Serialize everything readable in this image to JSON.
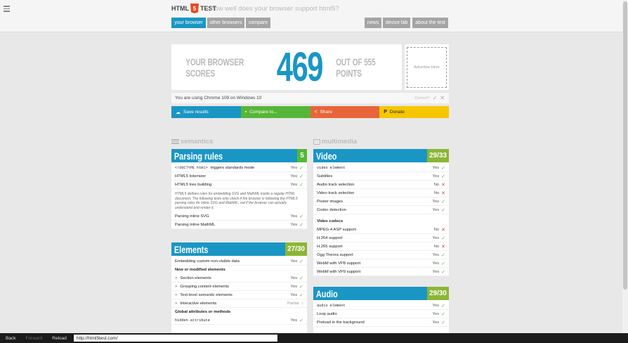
{
  "header": {
    "logo_left": "HTML",
    "logo_shield": "5",
    "logo_right": "TEST",
    "tagline": "how well does your browser support html5?"
  },
  "nav": {
    "your_browser": "your browser",
    "other_browsers": "other browsers",
    "compare": "compare",
    "news": "news",
    "device_lab": "device lab",
    "about": "about the test"
  },
  "score": {
    "prefix": "YOUR BROWSER SCORES",
    "value": "469",
    "suffix": "OUT OF 555 POINTS"
  },
  "ad": {
    "label": "Advertise Here"
  },
  "ua": {
    "text": "You are using Chrome 109 on Windows 10",
    "correct": "Correct?"
  },
  "actions": {
    "save": "Save results",
    "compare": "Compare to...",
    "share": "Share",
    "donate": "Donate"
  },
  "colors": {
    "blue": "#1a96c5",
    "green": "#56b638",
    "orange": "#e8643a",
    "yellow": "#f6c700"
  },
  "sections": {
    "semantics": "semantics",
    "multimedia": "multimedia"
  },
  "parsing": {
    "title": "Parsing rules",
    "score": "5",
    "rows": [
      {
        "label": "<!DOCTYPE html> triggers standards mode",
        "result": "Yes"
      },
      {
        "label": "HTML5 tokenizer",
        "result": "Yes"
      },
      {
        "label": "HTML5 tree building",
        "result": "Yes"
      }
    ],
    "note": "HTML5 defines rules for embedding SVG and MathML inside a regular HTML document. The following tests only check if the browser is following the HTML5 parsing rules for inline SVG and MathML, not if the browser can actually understand and render it.",
    "rows2": [
      {
        "label": "Parsing inline SVG",
        "result": "Yes"
      },
      {
        "label": "Parsing inline MathML",
        "result": "Yes"
      }
    ]
  },
  "elements": {
    "title": "Elements",
    "score": "27/30",
    "rows": [
      {
        "label": "Embedding custom non-visible data",
        "result": "Yes"
      }
    ],
    "group1": "New or modified elements",
    "rows2": [
      {
        "label": "Section elements",
        "result": "Yes"
      },
      {
        "label": "Grouping content elements",
        "result": "Yes"
      },
      {
        "label": "Text-level semantic elements",
        "result": "Yes"
      },
      {
        "label": "Interactive elements",
        "result": "Partial"
      }
    ],
    "group2": "Global attributes or methods",
    "rows3": [
      {
        "label": "hidden attribute",
        "result": "Yes"
      }
    ]
  },
  "video": {
    "title": "Video",
    "score": "29/33",
    "rows": [
      {
        "label": "video element",
        "result": "Yes"
      },
      {
        "label": "Subtitles",
        "result": "Yes"
      },
      {
        "label": "Audio track selection",
        "result": "No"
      },
      {
        "label": "Video track selection",
        "result": "No"
      },
      {
        "label": "Poster images",
        "result": "Yes"
      },
      {
        "label": "Codec detection",
        "result": "Yes"
      }
    ],
    "group": "Video codecs",
    "codecs": [
      {
        "label": "MPEG-4 ASP support",
        "result": "No"
      },
      {
        "label": "H.264 support",
        "result": "Yes"
      },
      {
        "label": "H.265 support",
        "result": "No"
      },
      {
        "label": "Ogg Theora support",
        "result": "Yes"
      },
      {
        "label": "WebM with VP8 support",
        "result": "Yes"
      },
      {
        "label": "WebM with VP9 support",
        "result": "Yes"
      }
    ]
  },
  "audio": {
    "title": "Audio",
    "score": "29/30",
    "rows": [
      {
        "label": "audio element",
        "result": "Yes"
      },
      {
        "label": "Loop audio",
        "result": "Yes"
      },
      {
        "label": "Preload in the background",
        "result": "Yes"
      }
    ]
  },
  "bottom": {
    "back": "Back",
    "forward": "Forward",
    "reload": "Reload",
    "url": "http://html5test.com/"
  }
}
